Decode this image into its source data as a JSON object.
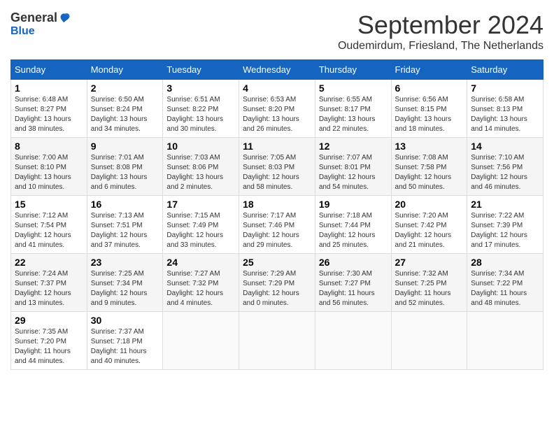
{
  "header": {
    "logo_general": "General",
    "logo_blue": "Blue",
    "month": "September 2024",
    "location": "Oudemirdum, Friesland, The Netherlands"
  },
  "columns": [
    "Sunday",
    "Monday",
    "Tuesday",
    "Wednesday",
    "Thursday",
    "Friday",
    "Saturday"
  ],
  "weeks": [
    [
      {
        "day": "1",
        "sunrise": "6:48 AM",
        "sunset": "8:27 PM",
        "daylight": "13 hours and 38 minutes."
      },
      {
        "day": "2",
        "sunrise": "6:50 AM",
        "sunset": "8:24 PM",
        "daylight": "13 hours and 34 minutes."
      },
      {
        "day": "3",
        "sunrise": "6:51 AM",
        "sunset": "8:22 PM",
        "daylight": "13 hours and 30 minutes."
      },
      {
        "day": "4",
        "sunrise": "6:53 AM",
        "sunset": "8:20 PM",
        "daylight": "13 hours and 26 minutes."
      },
      {
        "day": "5",
        "sunrise": "6:55 AM",
        "sunset": "8:17 PM",
        "daylight": "13 hours and 22 minutes."
      },
      {
        "day": "6",
        "sunrise": "6:56 AM",
        "sunset": "8:15 PM",
        "daylight": "13 hours and 18 minutes."
      },
      {
        "day": "7",
        "sunrise": "6:58 AM",
        "sunset": "8:13 PM",
        "daylight": "13 hours and 14 minutes."
      }
    ],
    [
      {
        "day": "8",
        "sunrise": "7:00 AM",
        "sunset": "8:10 PM",
        "daylight": "13 hours and 10 minutes."
      },
      {
        "day": "9",
        "sunrise": "7:01 AM",
        "sunset": "8:08 PM",
        "daylight": "13 hours and 6 minutes."
      },
      {
        "day": "10",
        "sunrise": "7:03 AM",
        "sunset": "8:06 PM",
        "daylight": "13 hours and 2 minutes."
      },
      {
        "day": "11",
        "sunrise": "7:05 AM",
        "sunset": "8:03 PM",
        "daylight": "12 hours and 58 minutes."
      },
      {
        "day": "12",
        "sunrise": "7:07 AM",
        "sunset": "8:01 PM",
        "daylight": "12 hours and 54 minutes."
      },
      {
        "day": "13",
        "sunrise": "7:08 AM",
        "sunset": "7:58 PM",
        "daylight": "12 hours and 50 minutes."
      },
      {
        "day": "14",
        "sunrise": "7:10 AM",
        "sunset": "7:56 PM",
        "daylight": "12 hours and 46 minutes."
      }
    ],
    [
      {
        "day": "15",
        "sunrise": "7:12 AM",
        "sunset": "7:54 PM",
        "daylight": "12 hours and 41 minutes."
      },
      {
        "day": "16",
        "sunrise": "7:13 AM",
        "sunset": "7:51 PM",
        "daylight": "12 hours and 37 minutes."
      },
      {
        "day": "17",
        "sunrise": "7:15 AM",
        "sunset": "7:49 PM",
        "daylight": "12 hours and 33 minutes."
      },
      {
        "day": "18",
        "sunrise": "7:17 AM",
        "sunset": "7:46 PM",
        "daylight": "12 hours and 29 minutes."
      },
      {
        "day": "19",
        "sunrise": "7:18 AM",
        "sunset": "7:44 PM",
        "daylight": "12 hours and 25 minutes."
      },
      {
        "day": "20",
        "sunrise": "7:20 AM",
        "sunset": "7:42 PM",
        "daylight": "12 hours and 21 minutes."
      },
      {
        "day": "21",
        "sunrise": "7:22 AM",
        "sunset": "7:39 PM",
        "daylight": "12 hours and 17 minutes."
      }
    ],
    [
      {
        "day": "22",
        "sunrise": "7:24 AM",
        "sunset": "7:37 PM",
        "daylight": "12 hours and 13 minutes."
      },
      {
        "day": "23",
        "sunrise": "7:25 AM",
        "sunset": "7:34 PM",
        "daylight": "12 hours and 9 minutes."
      },
      {
        "day": "24",
        "sunrise": "7:27 AM",
        "sunset": "7:32 PM",
        "daylight": "12 hours and 4 minutes."
      },
      {
        "day": "25",
        "sunrise": "7:29 AM",
        "sunset": "7:29 PM",
        "daylight": "12 hours and 0 minutes."
      },
      {
        "day": "26",
        "sunrise": "7:30 AM",
        "sunset": "7:27 PM",
        "daylight": "11 hours and 56 minutes."
      },
      {
        "day": "27",
        "sunrise": "7:32 AM",
        "sunset": "7:25 PM",
        "daylight": "11 hours and 52 minutes."
      },
      {
        "day": "28",
        "sunrise": "7:34 AM",
        "sunset": "7:22 PM",
        "daylight": "11 hours and 48 minutes."
      }
    ],
    [
      {
        "day": "29",
        "sunrise": "7:35 AM",
        "sunset": "7:20 PM",
        "daylight": "11 hours and 44 minutes."
      },
      {
        "day": "30",
        "sunrise": "7:37 AM",
        "sunset": "7:18 PM",
        "daylight": "11 hours and 40 minutes."
      },
      null,
      null,
      null,
      null,
      null
    ]
  ]
}
